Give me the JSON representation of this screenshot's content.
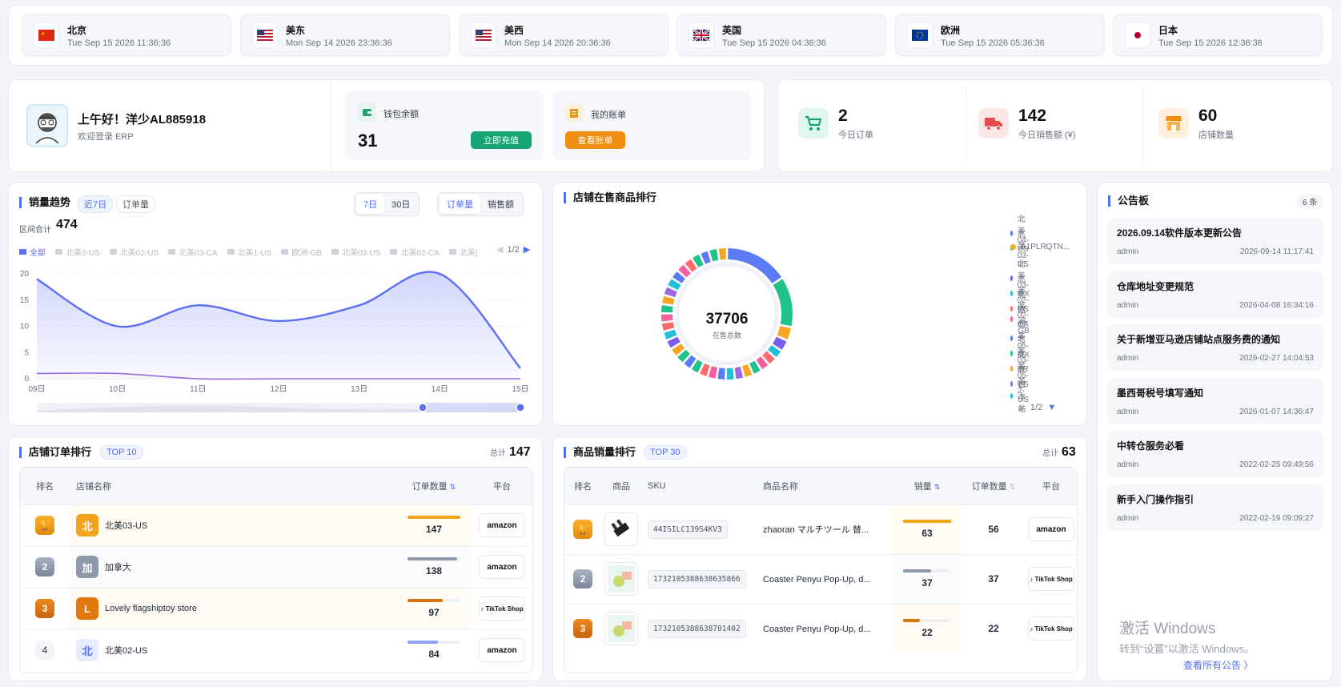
{
  "timezones": [
    {
      "name": "北京",
      "time": "Tue Sep 15 2026 11:36:36",
      "flag": "cn"
    },
    {
      "name": "美东",
      "time": "Mon Sep 14 2026 23:36:36",
      "flag": "us"
    },
    {
      "name": "美西",
      "time": "Mon Sep 14 2026 20:36:36",
      "flag": "us"
    },
    {
      "name": "英国",
      "time": "Tue Sep 15 2026 04:36:36",
      "flag": "uk"
    },
    {
      "name": "欧洲",
      "time": "Tue Sep 15 2026 05:36:36",
      "flag": "eu"
    },
    {
      "name": "日本",
      "time": "Tue Sep 15 2026 12:36:36",
      "flag": "jp"
    }
  ],
  "user": {
    "greeting": "上午好！洋少AL885918",
    "welcome": "欢迎登录 ERP"
  },
  "wallet": {
    "label": "钱包余额",
    "value": "31",
    "button": "立即充值"
  },
  "bill": {
    "label": "我的账单",
    "button": "查看账单"
  },
  "stats": [
    {
      "value": "2",
      "label": "今日订单",
      "icon": "cart-icon"
    },
    {
      "value": "142",
      "label": "今日销售额 (¥)",
      "icon": "truck-icon"
    },
    {
      "value": "60",
      "label": "店铺数量",
      "icon": "shop-icon"
    }
  ],
  "trend": {
    "title": "销量趋势",
    "range_pill": "近7日",
    "metric_pill": "订单量",
    "total_label": "区间合计",
    "total_value": "474",
    "period_tabs": [
      "7日",
      "30日"
    ],
    "metric_tabs": [
      "订单量",
      "销售额"
    ],
    "legend": [
      "全部",
      "北美2-US",
      "北美02-US",
      "北美03-CA",
      "北美1-US",
      "欧洲-GB",
      "北美03-US",
      "北美02-CA",
      "北美("
    ],
    "legend_page": "1/2"
  },
  "chart_data": [
    {
      "type": "area",
      "x": [
        "09日",
        "10日",
        "11日",
        "12日",
        "13日",
        "14日",
        "15日"
      ],
      "series": [
        {
          "name": "全部",
          "values": [
            19,
            10,
            14,
            11,
            14,
            20,
            2
          ]
        },
        {
          "values": [
            1,
            1,
            0,
            0,
            0,
            0,
            0
          ]
        }
      ],
      "yticks": [
        0,
        5,
        10,
        15,
        20
      ],
      "ylim": [
        0,
        20
      ],
      "colors": [
        "#5b6ef5",
        "#9a6ae0"
      ]
    },
    {
      "type": "pie",
      "title": "店铺在售商品排行",
      "center_value": "37706",
      "center_label": "在售总数",
      "legend": [
        "北美04-US",
        "北美03-US",
        "A1PLRQTN...",
        "北美03-MX",
        "北美02-US",
        "北美02-CA",
        "欧洲-GB",
        "北美05-MX",
        "北美03-BR",
        "北美05-US",
        "北美2-US",
        "日本站"
      ],
      "legend_colors": [
        "#5b7cf5",
        "#1fc28a",
        "#f5a623",
        "#7b5cf0",
        "#22c0d8",
        "#ff6b6b",
        "#f55f9e",
        "#5b7cf5",
        "#1fc28a",
        "#f5a623",
        "#9a6ae0",
        "#22c0d8"
      ],
      "legend_page": "1/2",
      "values": [
        14,
        11,
        3,
        2.5,
        2,
        2,
        2,
        2,
        2,
        2,
        2,
        2,
        2,
        2,
        2,
        2,
        2,
        2,
        2,
        2,
        2,
        2,
        2,
        2,
        2,
        2,
        2,
        2,
        2,
        2,
        2,
        2,
        2
      ]
    }
  ],
  "shop_rank": {
    "title": "店铺订单排行",
    "pill": "TOP 10",
    "total_label": "总计",
    "total_value": "147",
    "headers": [
      "排名",
      "店铺名称",
      "订单数量",
      "平台"
    ],
    "rows": [
      {
        "rank": "🏆",
        "avatar": "北",
        "name": "北美03-US",
        "count": "147",
        "pct": 1.0,
        "platform": "amazon",
        "medal": "gold"
      },
      {
        "rank": "2",
        "avatar": "加",
        "name": "加拿大",
        "count": "138",
        "pct": 0.94,
        "platform": "amazon",
        "medal": "silver"
      },
      {
        "rank": "3",
        "avatar": "L",
        "name": "Lovely flagshiptoy store",
        "count": "97",
        "pct": 0.66,
        "platform": "TikTok Shop",
        "medal": "bronze"
      },
      {
        "rank": "4",
        "avatar": "北",
        "name": "北美02-US",
        "count": "84",
        "pct": 0.57,
        "platform": "amazon",
        "medal": "none"
      }
    ]
  },
  "product_rank": {
    "title": "商品销量排行",
    "pill": "TOP 30",
    "total_label": "总计",
    "total_value": "63",
    "headers": [
      "排名",
      "商品",
      "SKU",
      "商品名称",
      "销量",
      "订单数量",
      "平台"
    ],
    "rows": [
      {
        "rank": "🏆",
        "sku": "44ISILC139S4KV3",
        "name": "zhaoran マルチツール 替...",
        "sales": "63",
        "orders": "56",
        "pct": 1.0,
        "platform": "amazon",
        "medal": "gold"
      },
      {
        "rank": "2",
        "sku": "1732105388638635866",
        "name": "Coaster Penyu Pop-Up, d...",
        "sales": "37",
        "orders": "37",
        "pct": 0.59,
        "platform": "TikTok Shop",
        "medal": "silver"
      },
      {
        "rank": "3",
        "sku": "1732105388638701402",
        "name": "Coaster Penyu Pop-Up, d...",
        "sales": "22",
        "orders": "22",
        "pct": 0.35,
        "platform": "TikTok Shop",
        "medal": "bronze"
      }
    ]
  },
  "notice": {
    "title": "公告板",
    "count": "6 条",
    "items": [
      {
        "title": "2026.09.14软件版本更新公告",
        "author": "admin",
        "date": "2026-09-14 11:17:41"
      },
      {
        "title": "仓库地址变更规范",
        "author": "admin",
        "date": "2026-04-08 16:34:16"
      },
      {
        "title": "关于新增亚马逊店铺站点服务费的通知",
        "author": "admin",
        "date": "2026-02-27 14:04:53"
      },
      {
        "title": "墨西哥税号填写通知",
        "author": "admin",
        "date": "2026-01-07 14:36:47"
      },
      {
        "title": "中转仓服务必看",
        "author": "admin",
        "date": "2022-02-25 09:49:56"
      },
      {
        "title": "新手入门操作指引",
        "author": "admin",
        "date": "2022-02-19 09:09:27"
      }
    ],
    "view_all": "查看所有公告 〉"
  },
  "watermark": {
    "line1": "激活 Windows",
    "line2": "转到“设置”以激活 Windows。"
  }
}
